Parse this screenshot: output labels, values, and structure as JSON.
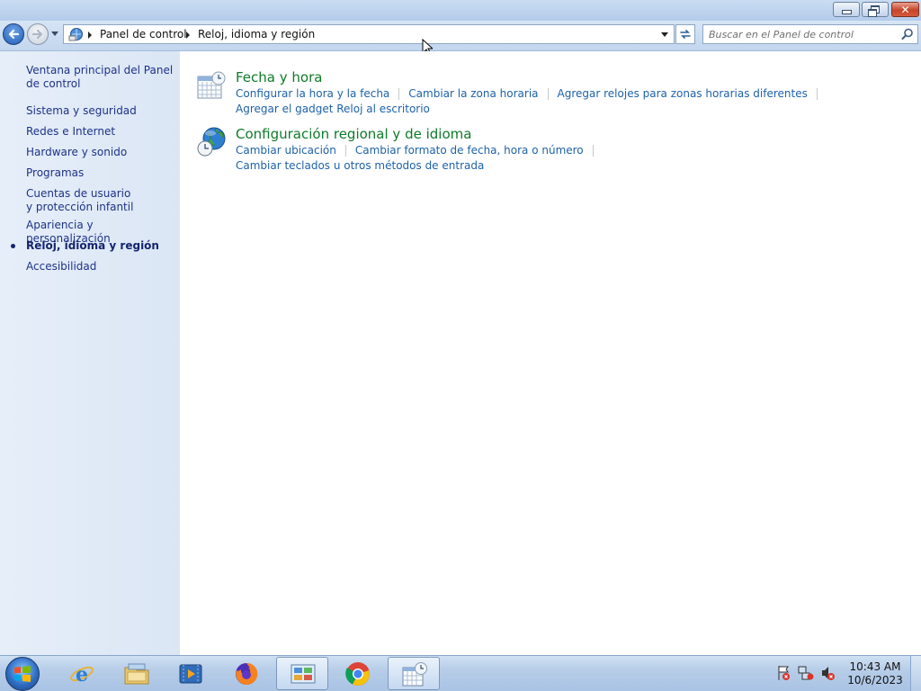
{
  "window": {
    "caption_buttons": {
      "minimize_icon": "minimize-icon",
      "restore_icon": "restore-icon",
      "close_icon": "close-icon",
      "close_glyph": "✕"
    }
  },
  "address_bar": {
    "breadcrumbs": [
      "Panel de control",
      "Reloj, idioma y región"
    ]
  },
  "search": {
    "placeholder": "Buscar en el Panel de control"
  },
  "sidebar": {
    "items": [
      {
        "label": "Ventana principal del Panel de control"
      },
      {
        "label": "Sistema y seguridad"
      },
      {
        "label": "Redes e Internet"
      },
      {
        "label": "Hardware y sonido"
      },
      {
        "label": "Programas"
      },
      {
        "label": "Cuentas de usuario y protección infantil"
      },
      {
        "label": "Apariencia y personalización"
      },
      {
        "label": "Reloj, idioma y región",
        "current": true
      },
      {
        "label": "Accesibilidad"
      }
    ]
  },
  "categories": [
    {
      "title": "Fecha y hora",
      "icon": "calendar-clock-icon",
      "links": [
        "Configurar la hora y la fecha",
        "Cambiar la zona horaria",
        "Agregar relojes para zonas horarias diferentes",
        "Agregar el gadget Reloj al escritorio"
      ]
    },
    {
      "title": "Configuración regional y de idioma",
      "icon": "globe-clock-icon",
      "links": [
        "Cambiar ubicación",
        "Cambiar formato de fecha, hora o número",
        "Cambiar teclados u otros métodos de entrada"
      ]
    }
  ],
  "taskbar": {
    "pinned": [
      "start-orb",
      "internet-explorer",
      "file-explorer",
      "media-player",
      "firefox",
      "control-panel",
      "chrome",
      "date-time-settings"
    ],
    "active": [
      "control-panel",
      "date-time-settings"
    ],
    "clock": {
      "time": "10:43 AM",
      "date": "10/6/2023"
    }
  },
  "colors": {
    "link": "#1e62a8",
    "category_title": "#0e7a29",
    "sidebar_link": "#1e3287",
    "sidebar_bg": "#dfe9f7"
  }
}
